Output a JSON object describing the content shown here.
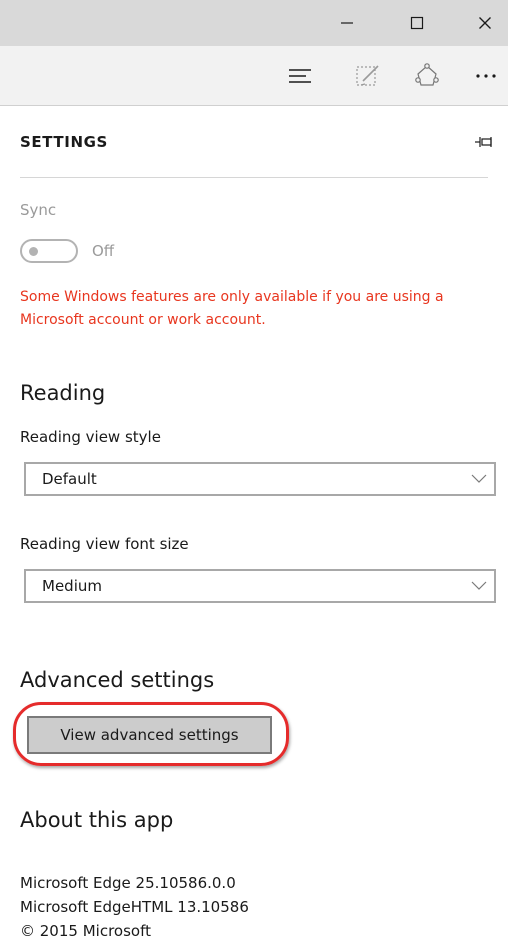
{
  "window": {
    "controls": [
      {
        "name": "minimize-icon"
      },
      {
        "name": "maximize-icon"
      },
      {
        "name": "close-icon"
      }
    ]
  },
  "toolbar": {
    "icons": [
      "hub-icon",
      "web-note-icon",
      "share-icon",
      "more-icon"
    ]
  },
  "settings": {
    "title": "SETTINGS",
    "sync": {
      "label": "Sync",
      "toggle_state": "Off",
      "warning": "Some Windows features are only available if you are using a Microsoft account or work account."
    },
    "reading": {
      "heading": "Reading",
      "view_style_label": "Reading view style",
      "view_style_value": "Default",
      "font_size_label": "Reading view font size",
      "font_size_value": "Medium"
    },
    "advanced": {
      "heading": "Advanced settings",
      "button_label": "View advanced settings"
    },
    "about": {
      "heading": "About this app",
      "lines": [
        "Microsoft Edge 25.10586.0.0",
        "Microsoft EdgeHTML 13.10586",
        "© 2015 Microsoft"
      ]
    }
  },
  "colors": {
    "warning": "#e8361f",
    "highlight": "#e52b2b",
    "titlebar": "#d9d9d9",
    "toolbar": "#f2f2f2"
  }
}
